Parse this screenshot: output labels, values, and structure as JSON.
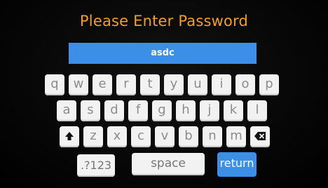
{
  "title": "Please Enter Password",
  "password_value": "asdc",
  "keyboard": {
    "row1": [
      "q",
      "w",
      "e",
      "r",
      "t",
      "y",
      "u",
      "i",
      "o",
      "p"
    ],
    "row2": [
      "a",
      "s",
      "d",
      "f",
      "g",
      "h",
      "j",
      "k",
      "l"
    ],
    "row3": [
      "z",
      "x",
      "c",
      "v",
      "b",
      "n",
      "m"
    ],
    "num_label": ".?123",
    "space_label": "space",
    "return_label": "return",
    "shift_icon": "shift-icon",
    "backspace_icon": "backspace-icon"
  },
  "colors": {
    "title": "#f0a020",
    "accent": "#3b8fe6",
    "key_bg": "#f2f2f2",
    "key_text": "#8c8c8c"
  }
}
